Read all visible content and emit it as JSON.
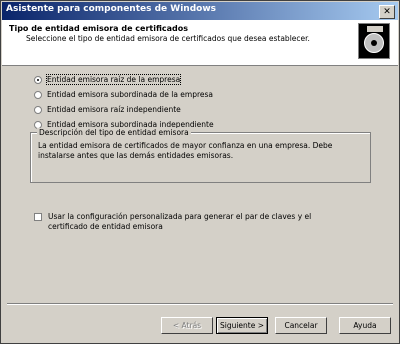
{
  "window": {
    "title": "Asistente para componentes de Windows",
    "close_glyph": "✕"
  },
  "header": {
    "title": "Tipo de entidad emisora de certificados",
    "subtitle": "Seleccione el tipo de entidad emisora de certificados que desea establecer.",
    "icon": "certificate-disc-icon"
  },
  "options": [
    {
      "label": "Entidad emisora raíz de la empresa",
      "checked": true
    },
    {
      "label": "Entidad emisora subordinada de la empresa",
      "checked": false
    },
    {
      "label": "Entidad emisora raíz independiente",
      "checked": false
    },
    {
      "label": "Entidad emisora subordinada independiente",
      "checked": false
    }
  ],
  "description": {
    "legend": "Descripción del tipo de entidad emisora",
    "text": "La entidad emisora de certificados de mayor confianza en una empresa. Debe instalarse antes que las demás entidades emisoras."
  },
  "custom_config": {
    "label": "Usar la configuración personalizada para generar el par de claves y el certificado de entidad emisora",
    "checked": false
  },
  "buttons": {
    "back": "< Atrás",
    "next": "Siguiente >",
    "cancel": "Cancelar",
    "help": "Ayuda"
  }
}
